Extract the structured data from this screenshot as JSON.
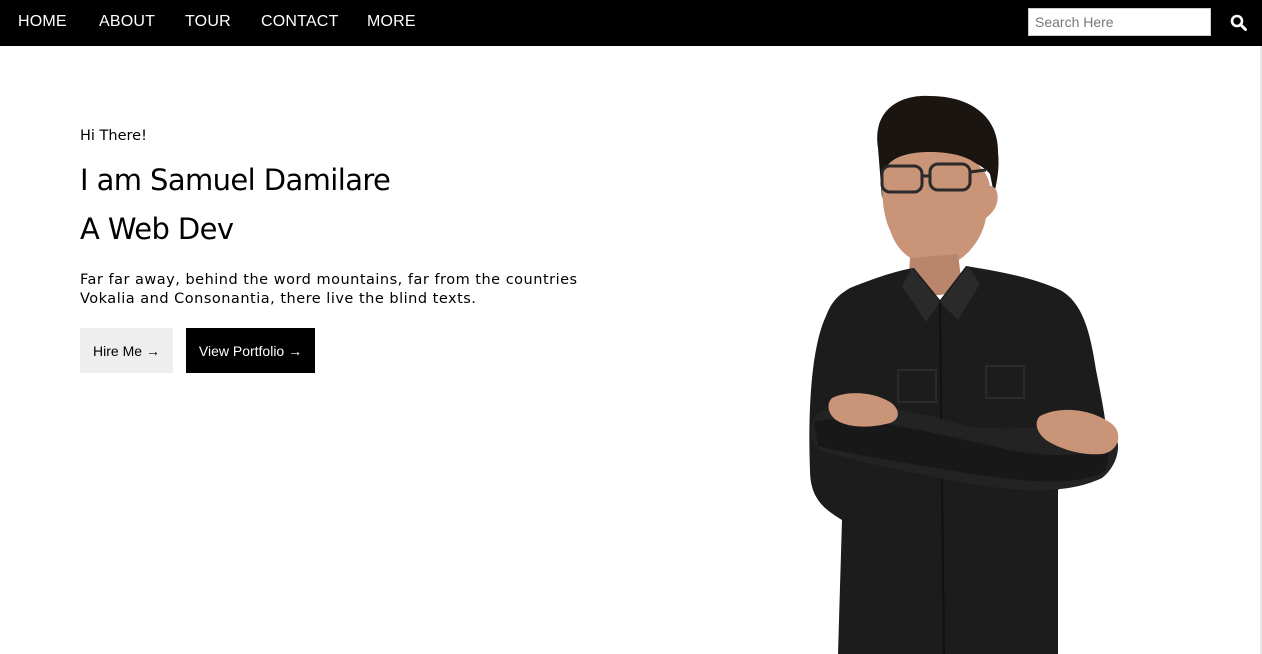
{
  "nav": {
    "items": [
      {
        "label": "HOME"
      },
      {
        "label": "ABOUT"
      },
      {
        "label": "TOUR"
      },
      {
        "label": "CONTACT"
      },
      {
        "label": "MORE"
      }
    ],
    "search": {
      "placeholder": "Search Here",
      "value": "",
      "icon": "search-icon"
    }
  },
  "hero": {
    "greeting": "Hi There!",
    "headline_line1": "I am Samuel Damilare",
    "headline_line2": "A Web Dev",
    "description": "Far far away, behind the word mountains, far from the countries Vokalia and Consonantia, there live the blind texts.",
    "buttons": {
      "hire": "Hire Me →",
      "portfolio": "View Portfolio →"
    },
    "image": {
      "subject": "portrait-photo"
    }
  },
  "colors": {
    "nav_bg": "#000000",
    "primary_button": "#000000",
    "secondary_button": "#eeeeee"
  }
}
